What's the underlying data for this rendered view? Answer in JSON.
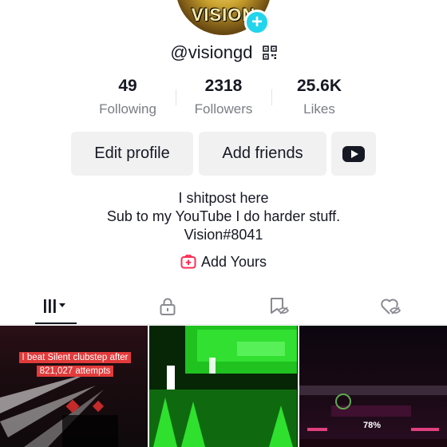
{
  "profile": {
    "avatar_text": "VISION",
    "username": "@visiongd"
  },
  "stats": [
    {
      "value": "49",
      "label": "Following"
    },
    {
      "value": "2318",
      "label": "Followers"
    },
    {
      "value": "25.6K",
      "label": "Likes"
    }
  ],
  "actions": {
    "edit_profile": "Edit profile",
    "add_friends": "Add friends"
  },
  "bio": {
    "line1": "I shitpost here",
    "line2": "Sub to my YouTube I do harder stuff.",
    "line3": "Vision#8041"
  },
  "add_yours": "Add Yours",
  "videos": [
    {
      "caption": "I beat Silent clubstep after 821,027 attempts"
    },
    {
      "caption": ""
    },
    {
      "caption": "78%"
    }
  ],
  "colors": {
    "accent_cyan": "#20d5ec",
    "brand_red": "#fe2c55",
    "button_bg": "#f1f1f2"
  }
}
